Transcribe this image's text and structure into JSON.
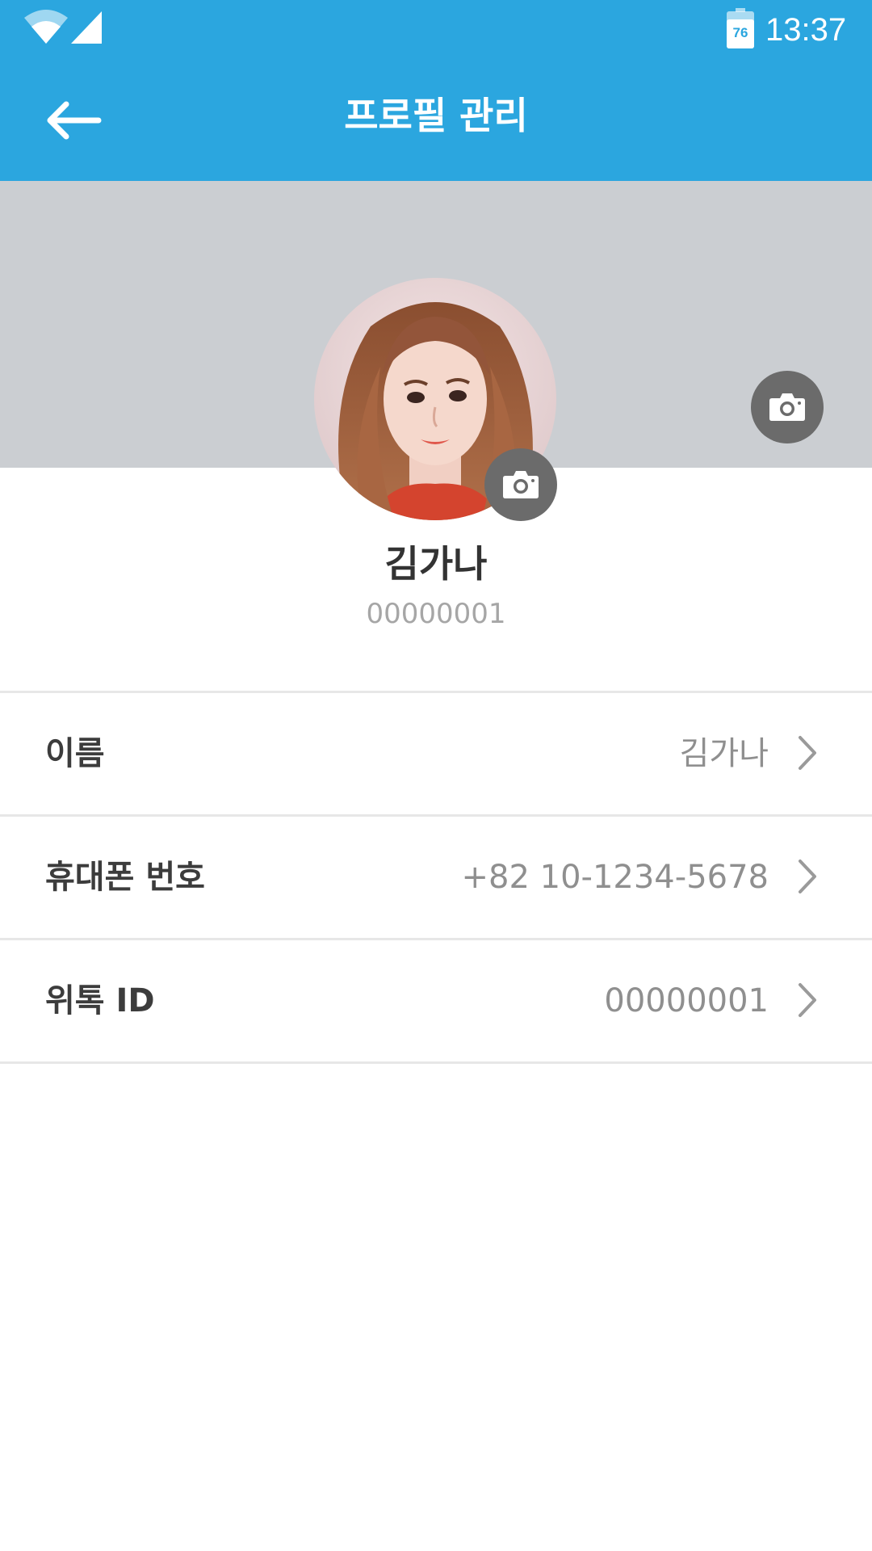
{
  "status_bar": {
    "battery_level": "76",
    "time": "13:37"
  },
  "toolbar": {
    "back_icon": "arrow-left-icon",
    "title": "프로필 관리"
  },
  "profile": {
    "name": "김가나",
    "id": "00000001",
    "camera_icon": "camera-icon"
  },
  "settings": {
    "rows": [
      {
        "label": "이름",
        "value": "김가나"
      },
      {
        "label": "휴대폰 번호",
        "value": "+82 10-1234-5678"
      },
      {
        "label": "위톡 ID",
        "value": "00000001"
      }
    ],
    "chevron_icon": "chevron-right-icon"
  },
  "colors": {
    "app_bar": "#2ba6df",
    "cover_background": "#cbced2",
    "camera_button": "#6b6b6b",
    "divider": "#e7e7e7",
    "label_text": "#3c3c3c",
    "value_text": "#8f8f8f"
  }
}
